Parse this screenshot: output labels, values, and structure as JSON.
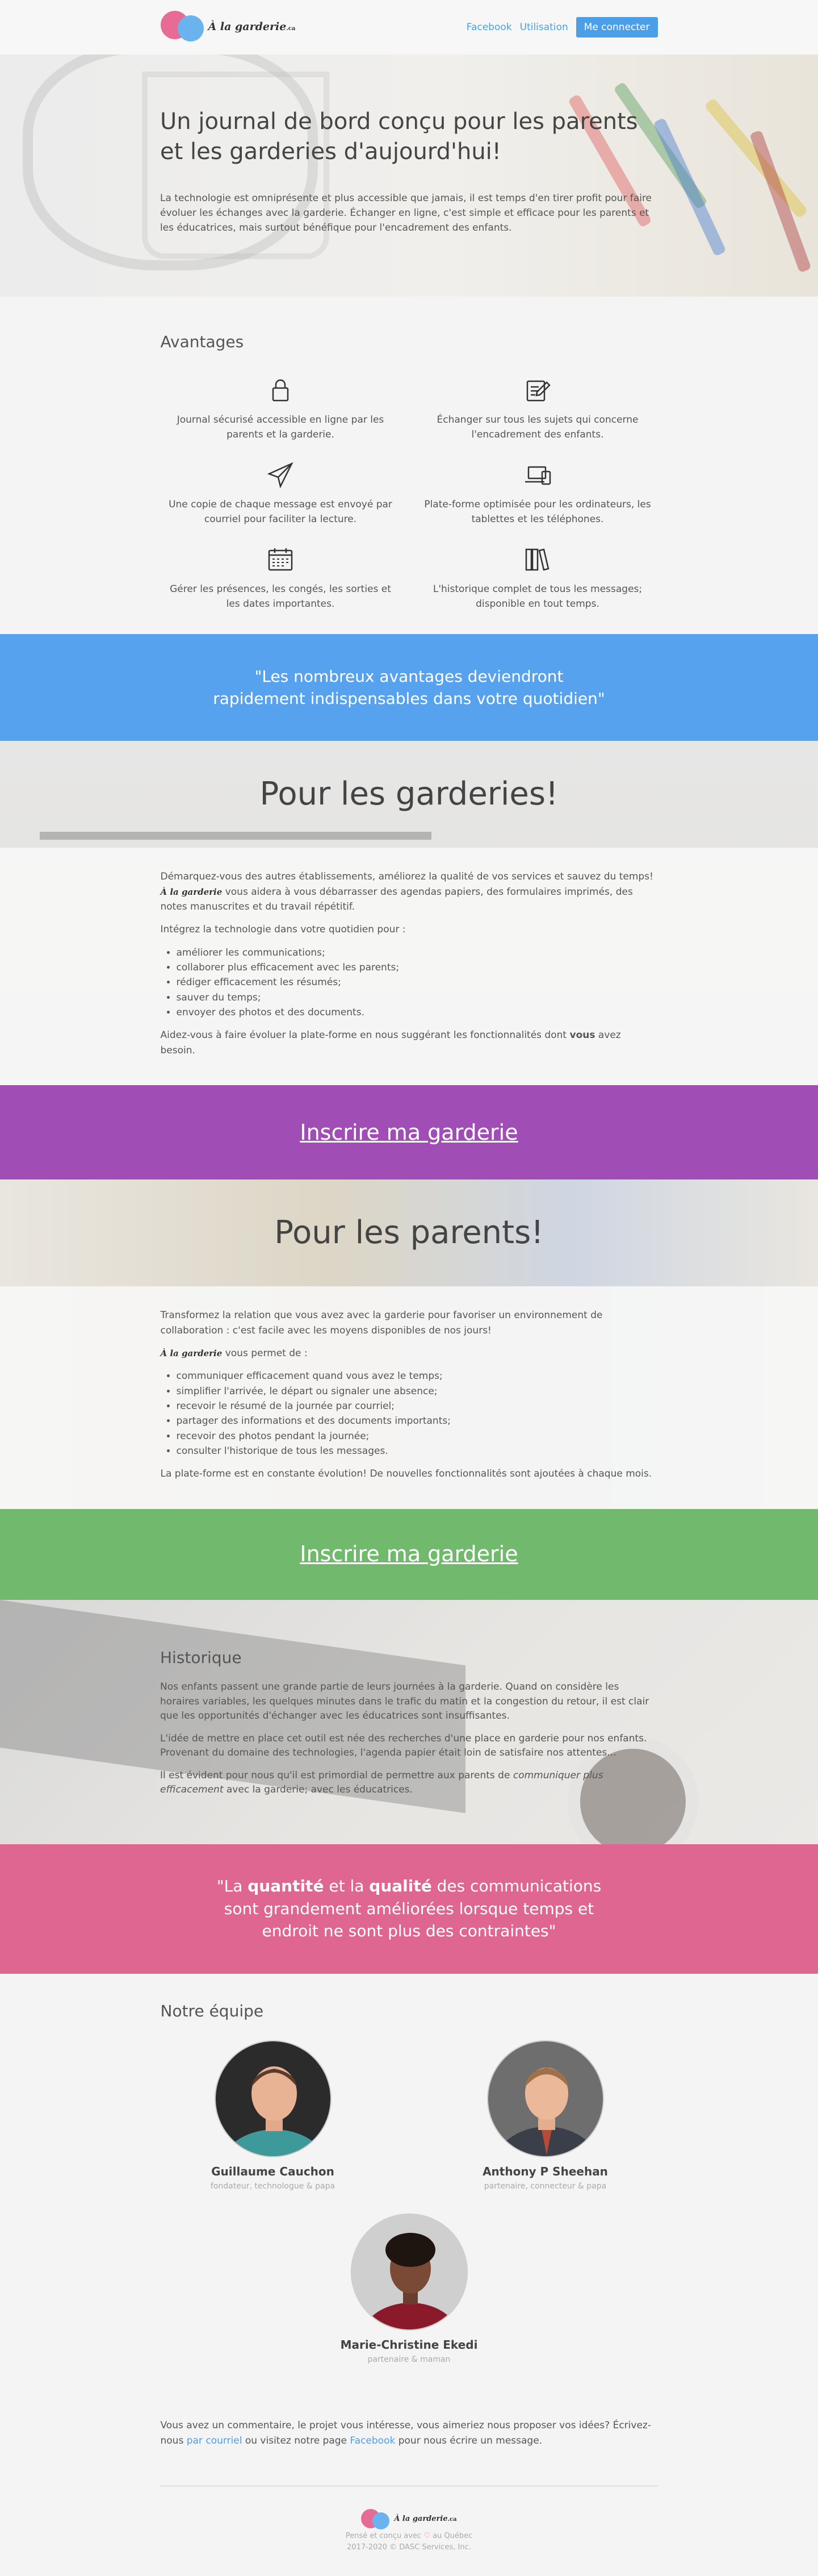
{
  "header": {
    "logo_text": "À la garderie",
    "logo_suffix": ".ca",
    "nav": [
      {
        "label": "Facebook"
      },
      {
        "label": "Utilisation"
      }
    ],
    "login_label": "Me connecter"
  },
  "hero": {
    "title": "Un journal de bord conçu pour les parents et les garderies d'aujourd'hui!",
    "text": "La technologie est omniprésente et plus accessible que jamais, il est temps d'en tirer profit pour faire évoluer les échanges avec la garderie. Échanger en ligne, c'est simple et efficace pour les parents et les éducatrices, mais surtout bénéfique pour l'encadrement des enfants."
  },
  "advantages": {
    "title": "Avantages",
    "items": [
      {
        "icon": "lock-icon",
        "text": "Journal sécurisé accessible en ligne par les parents et la garderie."
      },
      {
        "icon": "edit-icon",
        "text": "Échanger sur tous les sujets qui concerne l'encadrement des enfants."
      },
      {
        "icon": "paper-plane-icon",
        "text": "Une copie de chaque message est envoyé par courriel pour faciliter la lecture."
      },
      {
        "icon": "devices-icon",
        "text": "Plate-forme optimisée pour les ordinateurs, les tablettes et les téléphones."
      },
      {
        "icon": "calendar-icon",
        "text": "Gérer les présences, les congés, les sorties et les dates importantes."
      },
      {
        "icon": "books-icon",
        "text": "L'historique complet de tous les messages; disponible en tout temps."
      }
    ]
  },
  "quote1": "\"Les nombreux avantages deviendront rapidement indispensables dans votre quotidien\"",
  "garderies": {
    "title": "Pour les garderies!",
    "intro_before": "Démarquez-vous des autres établissements, améliorez la qualité de vos services et sauvez du temps!",
    "brand": "À la garderie",
    "intro_after": "vous aidera à vous débarrasser des agendas papiers, des formulaires imprimés, des notes manuscrites et du travail répétitif.",
    "lead": "Intégrez la technologie dans votre quotidien pour :",
    "list": [
      "améliorer les communications;",
      "collaborer plus efficacement avec les parents;",
      "rédiger efficacement les résumés;",
      "sauver du temps;",
      "envoyer des photos et des documents."
    ],
    "closing_before": "Aidez-vous à faire évoluer la plate-forme en nous suggérant les fonctionnalités dont",
    "closing_bold": "vous",
    "closing_after": "avez besoin."
  },
  "cta1": "Inscrire ma garderie",
  "parents": {
    "title": "Pour les parents!",
    "intro": "Transformez la relation que vous avez avec la garderie pour favoriser un environnement de collaboration : c'est facile avec les moyens disponibles de nos jours!",
    "brand": "À la garderie",
    "lead_after": "vous permet de :",
    "list": [
      "communiquer efficacement quand vous avez le temps;",
      "simplifier l'arrivée, le départ ou signaler une absence;",
      "recevoir le résumé de la journée par courriel;",
      "partager des informations et des documents importants;",
      "recevoir des photos pendant la journée;",
      "consulter l'historique de tous les messages."
    ],
    "closing": "La plate-forme est en constante évolution! De nouvelles fonctionnalités sont ajoutées à chaque mois."
  },
  "cta2": "Inscrire ma garderie",
  "history": {
    "title": "Historique",
    "p1": "Nos enfants passent une grande partie de leurs journées à la garderie. Quand on considère les horaires variables, les quelques minutes dans le trafic du matin et la congestion du retour, il est clair que les opportunités d'échanger avec les éducatrices sont insuffisantes.",
    "p2": "L'idée de mettre en place cet outil est née des recherches d'une place en garderie pour nos enfants. Provenant du domaine des technologies, l'agenda papier était loin de satisfaire nos attentes...",
    "p3_before": "Il est évident pour nous qu'il est primordial de permettre aux parents de",
    "p3_em": "communiquer plus efficacement",
    "p3_after": "avec la garderie; avec les éducatrices."
  },
  "quote2": {
    "open": "\"La",
    "b1": "quantité",
    "mid1": "et la",
    "b2": "qualité",
    "rest": "des communications sont grandement améliorées lorsque temps et endroit ne sont plus des contraintes\""
  },
  "team": {
    "title": "Notre équipe",
    "members": [
      {
        "name": "Guillaume Cauchon",
        "role": "fondateur, technologue & papa"
      },
      {
        "name": "Anthony P Sheehan",
        "role": "partenaire, connecteur & papa"
      },
      {
        "name": "Marie-Christine Ekedi",
        "role": "partenaire & maman"
      }
    ],
    "note_before": "Vous avez un commentaire, le projet vous intéresse, vous aimeriez nous proposer vos idées? Écrivez-nous",
    "email_link": "par courriel",
    "note_middle": "ou visitez notre page",
    "facebook_link": "Facebook",
    "note_after": "pour nous écrire un message."
  },
  "footer": {
    "line1_before": "Pensé et conçu avec",
    "line1_after": "au Québec",
    "line2": "2017-2020 © DASC Services, Inc."
  },
  "colors": {
    "blue": "#56a2ee",
    "purple": "#a04db6",
    "green": "#71b96c",
    "pink": "#df6690"
  }
}
